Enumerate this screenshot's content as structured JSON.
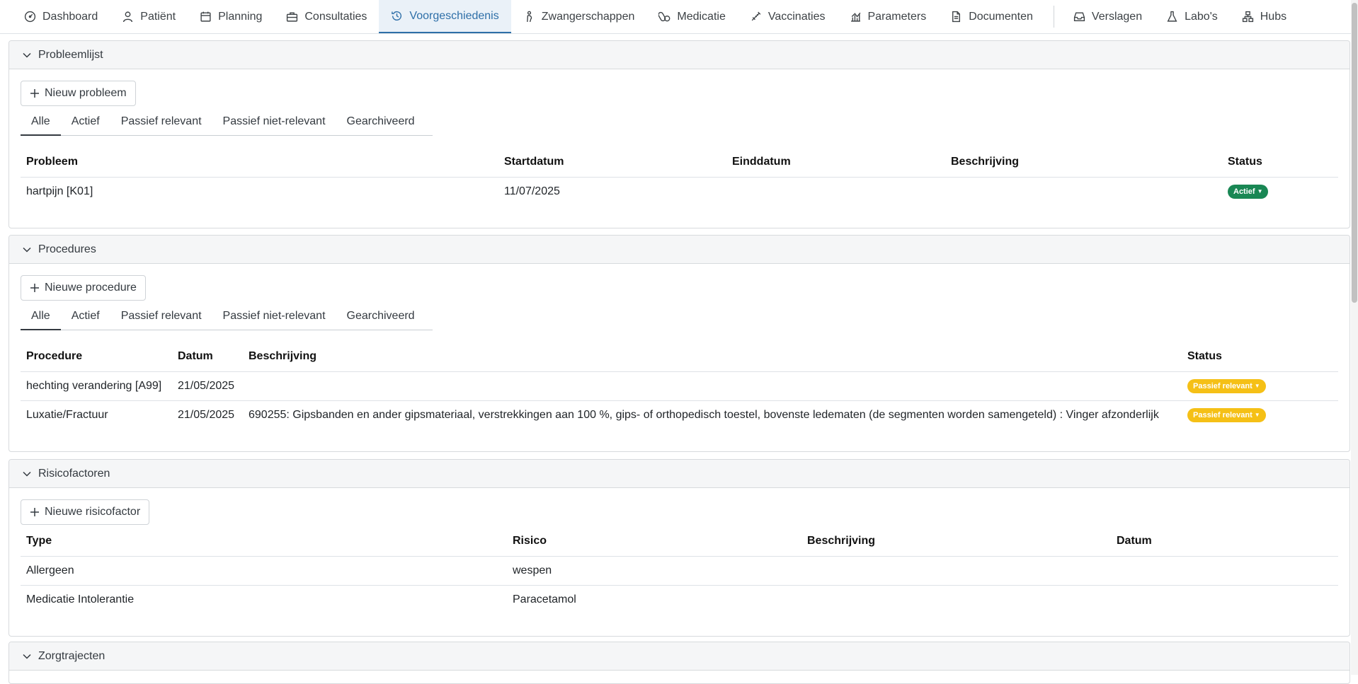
{
  "nav": {
    "tabs": [
      {
        "label": "Dashboard",
        "icon": "dashboard-icon"
      },
      {
        "label": "Patiënt",
        "icon": "user-icon"
      },
      {
        "label": "Planning",
        "icon": "calendar-icon"
      },
      {
        "label": "Consultaties",
        "icon": "briefcase-icon"
      },
      {
        "label": "Voorgeschiedenis",
        "icon": "history-icon",
        "active": true
      },
      {
        "label": "Zwangerschappen",
        "icon": "pregnancy-icon"
      },
      {
        "label": "Medicatie",
        "icon": "pills-icon"
      },
      {
        "label": "Vaccinaties",
        "icon": "syringe-icon"
      },
      {
        "label": "Parameters",
        "icon": "chart-icon"
      },
      {
        "label": "Documenten",
        "icon": "document-icon"
      },
      {
        "label": "Verslagen",
        "icon": "inbox-icon"
      },
      {
        "label": "Labo's",
        "icon": "flask-icon"
      },
      {
        "label": "Hubs",
        "icon": "hubs-icon"
      }
    ]
  },
  "colors": {
    "active_tab": "#2e6fa8",
    "status_active": "#198754",
    "status_passive_relevant": "#f5c016"
  },
  "filter_tabs": [
    "Alle",
    "Actief",
    "Passief relevant",
    "Passief niet-relevant",
    "Gearchiveerd"
  ],
  "problems": {
    "title": "Probleemlijst",
    "add_label": "Nieuw probleem",
    "columns": [
      "Probleem",
      "Startdatum",
      "Einddatum",
      "Beschrijving",
      "Status"
    ],
    "rows": [
      {
        "name": "hartpijn [K01]",
        "start": "11/07/2025",
        "end": "",
        "description": "",
        "status": "Actief"
      }
    ]
  },
  "procedures": {
    "title": "Procedures",
    "add_label": "Nieuwe procedure",
    "columns": [
      "Procedure",
      "Datum",
      "Beschrijving",
      "Status"
    ],
    "rows": [
      {
        "name": "hechting verandering [A99]",
        "date": "21/05/2025",
        "description": "",
        "status": "Passief relevant"
      },
      {
        "name": "Luxatie/Fractuur",
        "date": "21/05/2025",
        "description": "690255: Gipsbanden en ander gipsmateriaal, verstrekkingen aan 100 %, gips- of orthopedisch toestel, bovenste ledematen (de segmenten worden samengeteld) : Vinger afzonderlijk",
        "status": "Passief relevant"
      }
    ]
  },
  "risks": {
    "title": "Risicofactoren",
    "add_label": "Nieuwe risicofactor",
    "columns": [
      "Type",
      "Risico",
      "Beschrijving",
      "Datum"
    ],
    "rows": [
      {
        "type": "Allergeen",
        "risk": "wespen",
        "description": "",
        "date": ""
      },
      {
        "type": "Medicatie Intolerantie",
        "risk": "Paracetamol",
        "description": "",
        "date": ""
      }
    ]
  },
  "care": {
    "title": "Zorgtrajecten"
  }
}
